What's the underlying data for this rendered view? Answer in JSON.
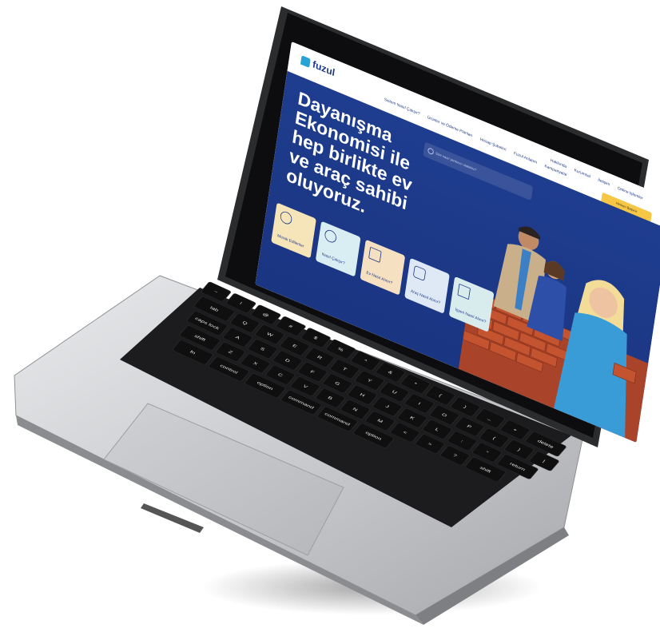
{
  "site": {
    "logo_text": "fuzul",
    "nav_items": [
      "Sistem Nasıl Çalışır?",
      "Ürünler ve Ödeme Planları",
      "Hesap Şubeleri",
      "Fuzul Anlatım",
      "Kampanyalar"
    ],
    "nav_top": [
      "Hakkında",
      "Kurumsal",
      "İletişim",
      "Online İşlemler"
    ],
    "cta_label": "Hemen Başvur",
    "search_placeholder": "Size nasıl yardımcı olabiliriz?",
    "hero_title": "Dayanışma Ekonomisi ile hep birlikte ev ve araç sahibi oluyoruz.",
    "cards": [
      {
        "label": "Merak Edilenler",
        "color": "#f6e5b8"
      },
      {
        "label": "Nasıl Çalışır?",
        "color": "#d9eef2"
      },
      {
        "label": "Ev Nasıl Alınır?",
        "color": "#f6e0c2"
      },
      {
        "label": "Araç Nasıl Alınır?",
        "color": "#dfe9f5"
      },
      {
        "label": "İşyeri Nasıl Alınır?",
        "color": "#d8ecee"
      }
    ],
    "colors": {
      "primary": "#1f3d8f",
      "accent": "#f6c744",
      "brick": "#c4542f"
    }
  },
  "keyboard": {
    "touchbar_keys": [
      "esc"
    ],
    "row1": [
      "~",
      "!",
      "@",
      "#",
      "$",
      "%",
      "^",
      "&",
      "*",
      "(",
      ")",
      "_",
      "+",
      "delete"
    ],
    "row2": [
      "tab",
      "Q",
      "W",
      "E",
      "R",
      "T",
      "Y",
      "U",
      "I",
      "O",
      "P",
      "{",
      "}",
      "|"
    ],
    "row3": [
      "caps lock",
      "A",
      "S",
      "D",
      "F",
      "G",
      "H",
      "J",
      "K",
      "L",
      ":",
      "\"",
      "return"
    ],
    "row4": [
      "shift",
      "Z",
      "X",
      "C",
      "V",
      "B",
      "N",
      "M",
      "<",
      ">",
      "?",
      "shift"
    ],
    "row5": [
      "fn",
      "control",
      "option",
      "command",
      "command",
      "option"
    ]
  }
}
